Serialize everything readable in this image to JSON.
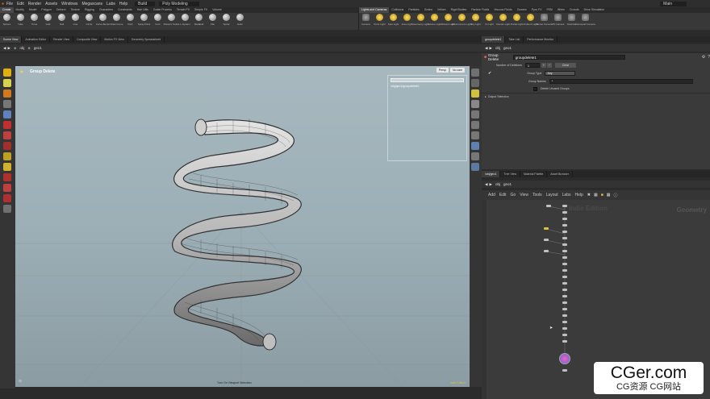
{
  "menu": {
    "items": [
      "File",
      "Edit",
      "Render",
      "Assets",
      "Windows",
      "Megascans",
      "Labs",
      "Help"
    ],
    "desktop": "Build",
    "desktop2": "Poly Modeling",
    "user": "Main"
  },
  "shelf": {
    "left_tabs": [
      "Create",
      "Modify",
      "Model",
      "Polygon",
      "Deform",
      "Texture",
      "Rigging",
      "Characters",
      "Constraints",
      "Hair Utils",
      "Guide Process",
      "Terrain FX",
      "Simple FX",
      "Volume"
    ],
    "left_tools": [
      "Sphere",
      "Tube",
      "Torus",
      "Grid",
      "Null",
      "Line",
      "Circle",
      "Curve Bezier",
      "Draw Curve",
      "Path",
      "Spray Paint",
      "Font",
      "Platonic Solids",
      "L-System",
      "Metaball",
      "File",
      "Spiral",
      "Helix"
    ],
    "right_tabs": [
      "Lights and Cameras",
      "Collisions",
      "Particles",
      "Grains",
      "Vellum",
      "Rigid Bodies",
      "Particle Fluids",
      "Viscous Fluids",
      "Oceans",
      "Pyro FX",
      "FEM",
      "Wires",
      "Crowds",
      "Drive Simulation"
    ],
    "right_tools": [
      "Camera",
      "Point Light",
      "Spot Light",
      "Area Light",
      "Geometry Light",
      "Volume Light",
      "Distant Light",
      "Environment Light",
      "Sky Light",
      "GI Light",
      "Caustic Light",
      "Portal Light",
      "Ambient Light",
      "Stereo Camera",
      "VR Camera",
      "Switcher",
      "Gamepad Camera"
    ]
  },
  "left_pane": {
    "tabs": [
      "Scene View",
      "Animation Editor",
      "Render View",
      "Composite View",
      "Motion FX View",
      "Geometry Spreadsheet"
    ],
    "path": [
      "obj",
      "geo1"
    ]
  },
  "viewport": {
    "title": "Group Delete",
    "buttons": [
      "Persp",
      "No cam"
    ],
    "info_path": "/obj/geo1/groupdelete1",
    "status": "Turn On Viewport Selection",
    "corner_label": "Indie Edition"
  },
  "params": {
    "tabs": [
      "groupdelete1",
      "Take List",
      "Performance Monitor"
    ],
    "path": [
      "obj",
      "geo1"
    ],
    "node_type": "Group Delete",
    "node_name": "groupdelete1",
    "num_deletions_label": "Number of Deletions",
    "num_deletions_value": "1",
    "clear_label": "Clear",
    "group_type_label": "Group Type",
    "group_type_value": "Any",
    "group_names_label": "Group Names",
    "group_names_value": "*",
    "delete_unused_label": "Delete Unused Groups",
    "output_selection_label": "Output Selection"
  },
  "network": {
    "tabs": [
      "/obj/geo1",
      "Tree View",
      "Material Palette",
      "Asset Browser"
    ],
    "path": [
      "obj",
      "geo1"
    ],
    "menu": [
      "Add",
      "Edit",
      "Go",
      "View",
      "Tools",
      "Layout",
      "Labs",
      "Help"
    ],
    "edition_label": "Indie Edition",
    "context_label": "Geometry"
  },
  "watermark": {
    "title": "CGer.com",
    "subtitle": "CG资源 CG网站"
  }
}
